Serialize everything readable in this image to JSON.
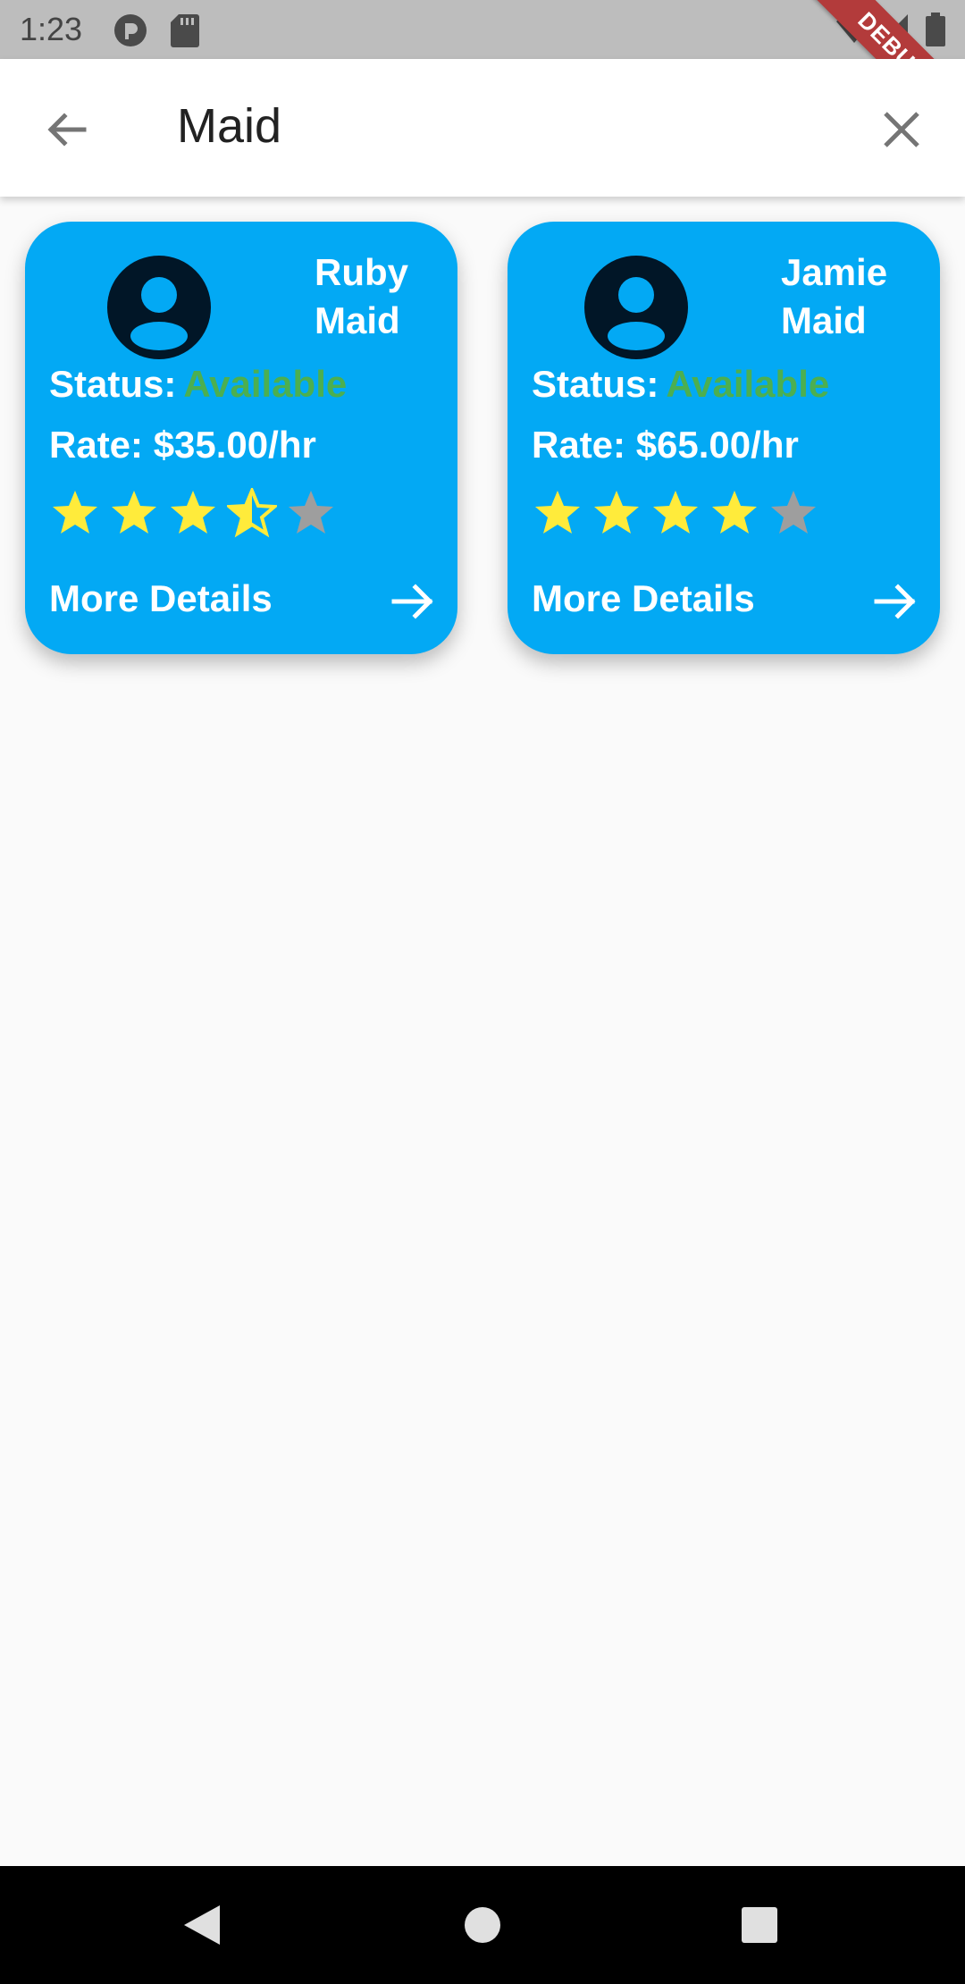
{
  "status_bar": {
    "time": "1:23",
    "debug_label": "DEBUG",
    "icons": [
      "notification-icon",
      "sd-card-icon",
      "wifi-icon",
      "signal-icon",
      "battery-icon"
    ]
  },
  "app_bar": {
    "title": "Maid",
    "back_icon": "arrow-back-icon",
    "close_icon": "close-icon"
  },
  "colors": {
    "card_bg": "#03a9f4",
    "available": "#4caf50",
    "star_filled": "#ffeb3b",
    "star_empty": "#9e9e9e",
    "avatar": "#011627"
  },
  "cards": [
    {
      "first_name": "Ruby",
      "last_name": "Maid",
      "status_label": "Status:",
      "status_value": "Available",
      "rate": "Rate: $35.00/hr",
      "rating": 3.5,
      "rating_max": 5,
      "more_label": "More Details"
    },
    {
      "first_name": "Jamie",
      "last_name": "Maid",
      "status_label": "Status:",
      "status_value": "Available",
      "rate": "Rate: $65.00/hr",
      "rating": 4,
      "rating_max": 5,
      "more_label": "More Details"
    }
  ],
  "nav_bar": {
    "icons": [
      "nav-back-icon",
      "nav-home-icon",
      "nav-recents-icon"
    ]
  }
}
